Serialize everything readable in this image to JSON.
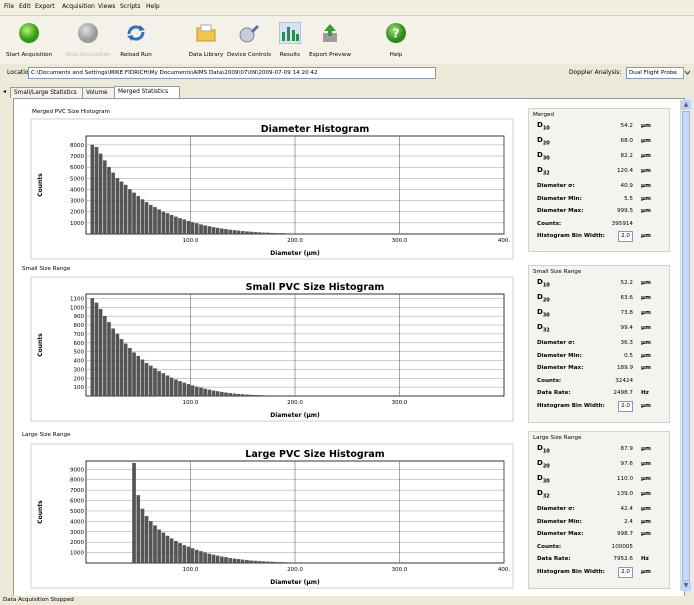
{
  "menu": [
    "File",
    "Edit",
    "Export",
    "Acquisition",
    "Views",
    "Scripts",
    "Help"
  ],
  "toolbar": {
    "items": [
      {
        "label": "Start Acquisition",
        "icon": "green-circle-icon",
        "enabled": true
      },
      {
        "label": "Stop Acquisition",
        "icon": "gray-circle-icon",
        "enabled": false
      },
      {
        "label": "Reload Run",
        "icon": "reload-icon",
        "enabled": true
      },
      {
        "label": "Data Library",
        "icon": "folder-icon",
        "enabled": true
      },
      {
        "label": "Device Controls",
        "icon": "wrench-icon",
        "enabled": true
      },
      {
        "label": "Results",
        "icon": "bar-chart-icon",
        "enabled": true
      },
      {
        "label": "Export Preview",
        "icon": "export-icon",
        "enabled": true
      },
      {
        "label": "Help",
        "icon": "help-icon",
        "enabled": true
      }
    ]
  },
  "location": {
    "label": "Location:",
    "value": "C:\\Documents and Settings\\MIKE FIDRICH\\My Documents\\AIMS Data\\2009\\07\\09\\2009-07-09 14 20 42"
  },
  "doppler": {
    "label": "Doppler Analysis:",
    "value": "Dual Flight Probe"
  },
  "tabs": [
    {
      "label": "Small/Large Statistics",
      "active": false
    },
    {
      "label": "Volume",
      "active": false
    },
    {
      "label": "Merged Statistics",
      "active": true
    }
  ],
  "sections": [
    {
      "title": "Merged PVC Size Histogram",
      "stats_title": "Merged",
      "stats": [
        {
          "name": "D",
          "sub": "10",
          "value": "54.2",
          "unit": "µm"
        },
        {
          "name": "D",
          "sub": "20",
          "value": "68.0",
          "unit": "µm"
        },
        {
          "name": "D",
          "sub": "30",
          "value": "82.2",
          "unit": "µm"
        },
        {
          "name": "D",
          "sub": "32",
          "value": "120.4",
          "unit": "µm"
        },
        {
          "name": "Diameter σ:",
          "value": "40.9",
          "unit": "µm"
        },
        {
          "name": "Diameter Min:",
          "value": "5.5",
          "unit": "µm"
        },
        {
          "name": "Diameter Max:",
          "value": "999.5",
          "unit": "µm"
        },
        {
          "name": "Counts:",
          "value": "395914",
          "unit": ""
        },
        {
          "name": "Histogram Bin Width:",
          "value": "2.0",
          "unit": "µm",
          "input": true
        }
      ]
    },
    {
      "title": "Small Size Range",
      "stats_title": "Small Size Range",
      "stats": [
        {
          "name": "D",
          "sub": "10",
          "value": "52.2",
          "unit": "µm"
        },
        {
          "name": "D",
          "sub": "20",
          "value": "63.6",
          "unit": "µm"
        },
        {
          "name": "D",
          "sub": "30",
          "value": "73.8",
          "unit": "µm"
        },
        {
          "name": "D",
          "sub": "32",
          "value": "99.4",
          "unit": "µm"
        },
        {
          "name": "Diameter σ:",
          "value": "36.3",
          "unit": "µm"
        },
        {
          "name": "Diameter Min:",
          "value": "0.5",
          "unit": "µm"
        },
        {
          "name": "Diameter Max:",
          "value": "189.9",
          "unit": "µm"
        },
        {
          "name": "Counts:",
          "value": "32424",
          "unit": ""
        },
        {
          "name": "Data Rate:",
          "value": "2498.7",
          "unit": "Hz"
        },
        {
          "name": "Histogram Bin Width:",
          "value": "2.0",
          "unit": "µm",
          "input": true
        }
      ]
    },
    {
      "title": "Large Size Range",
      "stats_title": "Large Size Range",
      "stats": [
        {
          "name": "D",
          "sub": "10",
          "value": "87.9",
          "unit": "µm"
        },
        {
          "name": "D",
          "sub": "20",
          "value": "97.6",
          "unit": "µm"
        },
        {
          "name": "D",
          "sub": "30",
          "value": "110.0",
          "unit": "µm"
        },
        {
          "name": "D",
          "sub": "32",
          "value": "139.0",
          "unit": "µm"
        },
        {
          "name": "Diameter σ:",
          "value": "42.4",
          "unit": "µm"
        },
        {
          "name": "Diameter Min:",
          "value": "2.4",
          "unit": "µm"
        },
        {
          "name": "Diameter Max:",
          "value": "998.7",
          "unit": "µm"
        },
        {
          "name": "Counts:",
          "value": "100005",
          "unit": ""
        },
        {
          "name": "Data Rate:",
          "value": "7952.6",
          "unit": "Hz"
        },
        {
          "name": "Histogram Bin Width:",
          "value": "2.0",
          "unit": "µm",
          "input": true
        }
      ]
    }
  ],
  "chart_data": [
    {
      "type": "bar",
      "title": "Diameter Histogram",
      "xlabel": "Diameter (µm)",
      "ylabel": "Counts",
      "xlim": [
        0,
        400
      ],
      "ylim": [
        0,
        8800
      ],
      "xticks": [
        "100.0",
        "200.0",
        "300.0",
        "400."
      ],
      "yticks": [
        "1000",
        "2000",
        "3000",
        "4000",
        "5000",
        "6000",
        "7000",
        "8000"
      ],
      "grid": true,
      "x": [
        6,
        10,
        14,
        18,
        22,
        26,
        30,
        34,
        38,
        42,
        46,
        50,
        54,
        58,
        62,
        66,
        70,
        74,
        78,
        82,
        86,
        90,
        94,
        98,
        102,
        106,
        110,
        114,
        118,
        122,
        126,
        130,
        134,
        138,
        142,
        146,
        150,
        154,
        158,
        162,
        166,
        170,
        174,
        178,
        182,
        186,
        190,
        194,
        198,
        202,
        206,
        210
      ],
      "values": [
        8000,
        7800,
        7200,
        6600,
        6000,
        5500,
        5000,
        4700,
        4400,
        4000,
        3700,
        3400,
        3100,
        2850,
        2600,
        2400,
        2200,
        2000,
        1850,
        1700,
        1550,
        1400,
        1300,
        1150,
        1050,
        950,
        850,
        760,
        680,
        600,
        540,
        480,
        420,
        370,
        330,
        290,
        250,
        220,
        190,
        160,
        140,
        120,
        100,
        85,
        70,
        60,
        50,
        40,
        30,
        25,
        18,
        12
      ]
    },
    {
      "type": "bar",
      "title": "Small PVC Size Histogram",
      "xlabel": "Diameter (µm)",
      "ylabel": "Counts",
      "xlim": [
        0,
        400
      ],
      "ylim": [
        0,
        1150
      ],
      "xticks": [
        "100.0",
        "200.0",
        "300.0"
      ],
      "yticks": [
        "100",
        "200",
        "300",
        "400",
        "500",
        "600",
        "700",
        "800",
        "900",
        "1000",
        "1100"
      ],
      "grid": true,
      "x": [
        6,
        10,
        14,
        18,
        22,
        26,
        30,
        34,
        38,
        42,
        46,
        50,
        54,
        58,
        62,
        66,
        70,
        74,
        78,
        82,
        86,
        90,
        94,
        98,
        102,
        106,
        110,
        114,
        118,
        122,
        126,
        130,
        134,
        138,
        142,
        146,
        150,
        154,
        158,
        162,
        166,
        170,
        174,
        178,
        182,
        186
      ],
      "values": [
        1100,
        1050,
        980,
        900,
        830,
        760,
        700,
        640,
        590,
        540,
        490,
        450,
        410,
        370,
        340,
        310,
        280,
        255,
        230,
        205,
        185,
        165,
        148,
        132,
        118,
        104,
        92,
        80,
        70,
        60,
        52,
        45,
        38,
        32,
        27,
        22,
        18,
        15,
        12,
        10,
        8,
        6,
        5,
        4,
        3,
        2
      ]
    },
    {
      "type": "bar",
      "title": "Large PVC Size Histogram",
      "xlabel": "Diameter (µm)",
      "ylabel": "Counts",
      "xlim": [
        0,
        400
      ],
      "ylim": [
        0,
        9800
      ],
      "xticks": [
        "100.0",
        "200.0",
        "300.0",
        "400."
      ],
      "yticks": [
        "1000",
        "2000",
        "3000",
        "4000",
        "5000",
        "6000",
        "7000",
        "8000",
        "9000"
      ],
      "grid": true,
      "x": [
        46,
        50,
        54,
        58,
        62,
        66,
        70,
        74,
        78,
        82,
        86,
        90,
        94,
        98,
        102,
        106,
        110,
        114,
        118,
        122,
        126,
        130,
        134,
        138,
        142,
        146,
        150,
        154,
        158,
        162,
        166,
        170,
        174,
        178,
        182,
        186,
        190,
        194,
        198,
        202,
        206,
        210
      ],
      "values": [
        9600,
        6500,
        5200,
        4500,
        4000,
        3600,
        3200,
        2900,
        2600,
        2350,
        2100,
        1900,
        1700,
        1550,
        1400,
        1250,
        1120,
        1000,
        880,
        780,
        690,
        610,
        540,
        470,
        410,
        360,
        310,
        270,
        230,
        200,
        170,
        145,
        120,
        100,
        82,
        68,
        55,
        44,
        34,
        26,
        18,
        12
      ]
    }
  ],
  "status": "Data Acquisition Stopped"
}
